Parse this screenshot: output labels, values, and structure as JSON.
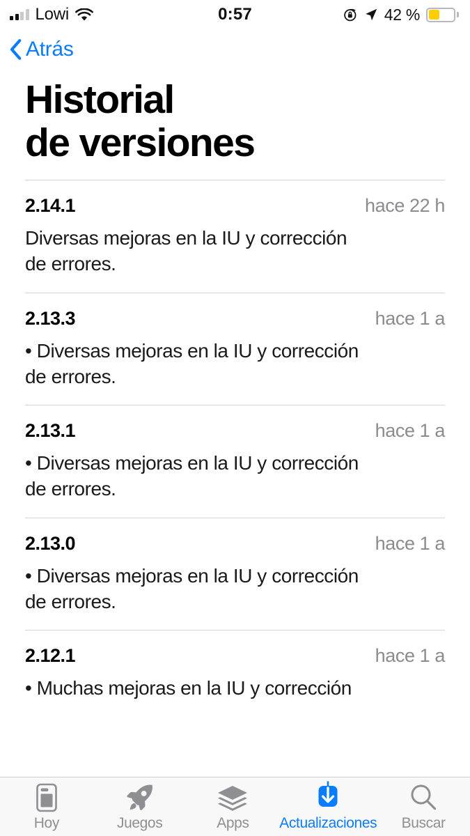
{
  "status_bar": {
    "carrier": "Lowi",
    "signal_bars_filled": 2,
    "signal_bars_total": 4,
    "wifi_icon": "wifi-icon",
    "time": "0:57",
    "rotation_lock_icon": "rotation-lock-icon",
    "location_icon": "location-arrow-icon",
    "battery_percent": "42 %",
    "battery_level": 42,
    "battery_color": "#ffcc00"
  },
  "nav": {
    "back_label": "Atrás",
    "back_icon": "chevron-left-icon",
    "accent_color": "#0a7cff"
  },
  "page": {
    "title_line1": "Historial",
    "title_line2": "de versiones"
  },
  "entries": [
    {
      "version": "2.14.1",
      "ago": "hace 22 h",
      "notes": "Diversas mejoras en la IU y corrección\nde errores."
    },
    {
      "version": "2.13.3",
      "ago": "hace 1 a",
      "notes": "• Diversas mejoras en la IU y corrección\nde errores."
    },
    {
      "version": "2.13.1",
      "ago": "hace 1 a",
      "notes": "• Diversas mejoras en la IU y corrección\nde errores."
    },
    {
      "version": "2.13.0",
      "ago": "hace 1 a",
      "notes": "• Diversas mejoras en la IU y corrección\nde errores."
    },
    {
      "version": "2.12.1",
      "ago": "hace 1 a",
      "notes": "• Muchas mejoras en la IU y corrección"
    }
  ],
  "tabbar": {
    "active_color": "#0a7cff",
    "inactive_color": "#8e8e93",
    "items": [
      {
        "label": "Hoy",
        "icon": "today-card-icon",
        "active": false
      },
      {
        "label": "Juegos",
        "icon": "rocket-icon",
        "active": false
      },
      {
        "label": "Apps",
        "icon": "layers-stack-icon",
        "active": false
      },
      {
        "label": "Actualizaciones",
        "icon": "download-arrow-icon",
        "active": true
      },
      {
        "label": "Buscar",
        "icon": "search-icon",
        "active": false
      }
    ]
  }
}
